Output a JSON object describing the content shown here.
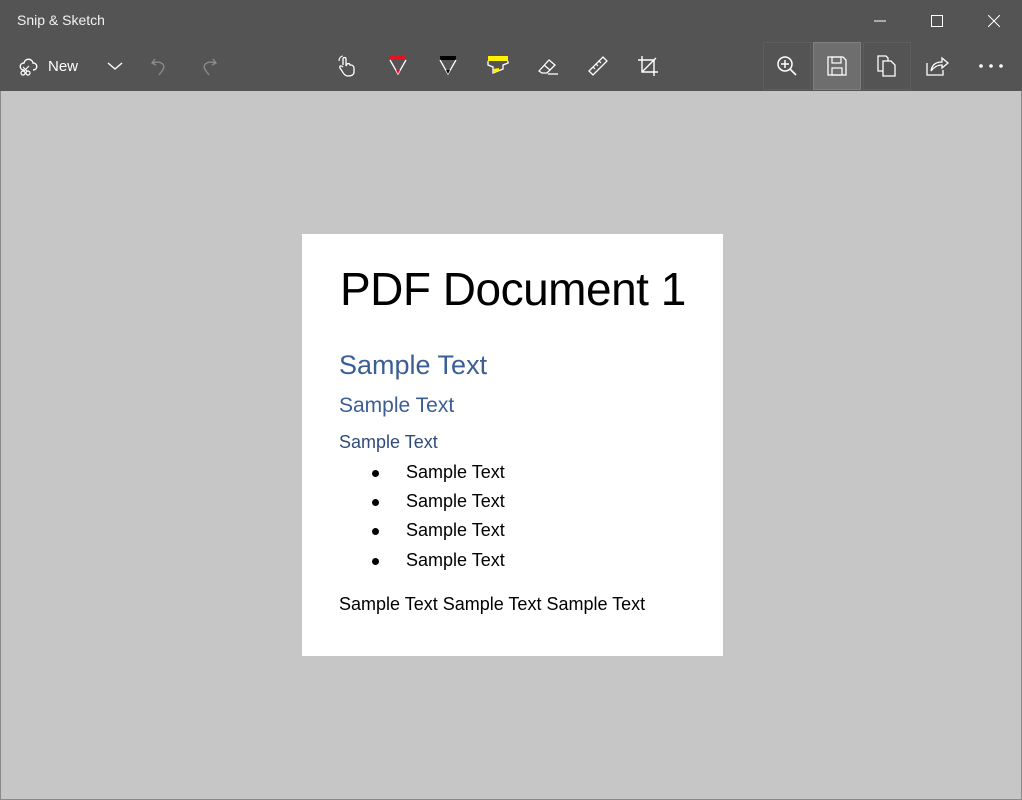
{
  "window": {
    "title": "Snip & Sketch",
    "controls": {
      "minimize": "minimize-icon",
      "maximize": "maximize-icon",
      "close": "close-icon"
    }
  },
  "toolbar": {
    "new_label": "New",
    "left_tools": [
      "new-snip-icon",
      "chevron-down-icon",
      "undo-icon",
      "redo-icon"
    ],
    "drawing_tools": [
      "touch-writing-icon",
      "ballpoint-pen-icon",
      "pencil-icon",
      "highlighter-icon",
      "eraser-icon",
      "ruler-icon",
      "crop-icon"
    ],
    "right_tools": [
      "zoom-in-icon",
      "save-icon",
      "copy-icon",
      "share-icon",
      "more-icon"
    ],
    "colors": {
      "pen": "#e81123",
      "pencil": "#000000",
      "highlighter": "#fff100"
    }
  },
  "document": {
    "title": "PDF Document 1",
    "heading1": "Sample Text",
    "heading2": "Sample Text",
    "heading3": "Sample Text",
    "bullets": [
      "Sample Text",
      "Sample Text",
      "Sample Text",
      "Sample Text"
    ],
    "paragraph": "Sample Text Sample Text Sample Text",
    "heading_color": "#3b5f94"
  }
}
